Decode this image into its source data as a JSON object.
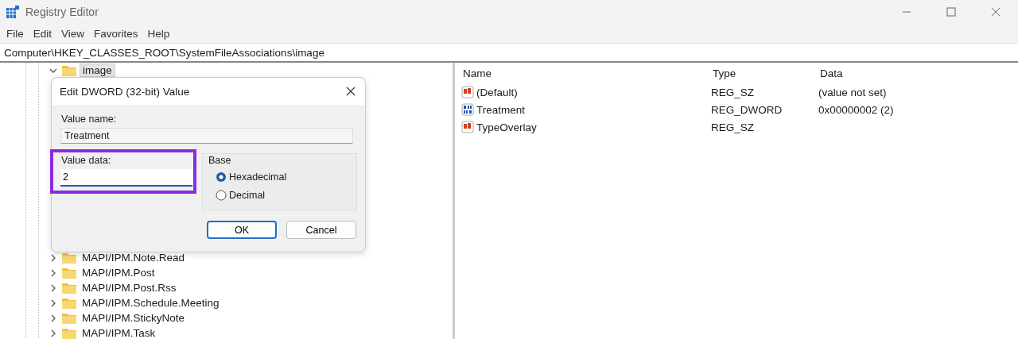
{
  "window": {
    "title": "Registry Editor"
  },
  "menu": [
    "File",
    "Edit",
    "View",
    "Favorites",
    "Help"
  ],
  "address": "Computer\\HKEY_CLASSES_ROOT\\SystemFileAssociations\\image",
  "tree": {
    "items": [
      {
        "label": "image",
        "expanded": true,
        "selected": true
      },
      {
        "label": "MAPI/IPM.Note.Read",
        "expanded": false,
        "selected": false
      },
      {
        "label": "MAPI/IPM.Post",
        "expanded": false,
        "selected": false
      },
      {
        "label": "MAPI/IPM.Post.Rss",
        "expanded": false,
        "selected": false
      },
      {
        "label": "MAPI/IPM.Schedule.Meeting",
        "expanded": false,
        "selected": false
      },
      {
        "label": "MAPI/IPM.StickyNote",
        "expanded": false,
        "selected": false
      },
      {
        "label": "MAPI/IPM.Task",
        "expanded": false,
        "selected": false
      }
    ]
  },
  "values": {
    "columns": [
      "Name",
      "Type",
      "Data"
    ],
    "rows": [
      {
        "kind": "string",
        "name": "(Default)",
        "type": "REG_SZ",
        "data": "(value not set)"
      },
      {
        "kind": "binary",
        "name": "Treatment",
        "type": "REG_DWORD",
        "data": "0x00000002 (2)"
      },
      {
        "kind": "string",
        "name": "TypeOverlay",
        "type": "REG_SZ"
      }
    ]
  },
  "dialog": {
    "title": "Edit DWORD (32-bit) Value",
    "value_name_label": "Value name:",
    "value_name": "Treatment",
    "value_data_label": "Value data:",
    "value_data": "2",
    "base_label": "Base",
    "bases": [
      {
        "label": "Hexadecimal",
        "selected": true
      },
      {
        "label": "Decimal",
        "selected": false
      }
    ],
    "buttons": [
      {
        "label": "OK",
        "kind": "default"
      },
      {
        "label": "Cancel",
        "kind": "normal"
      }
    ]
  }
}
